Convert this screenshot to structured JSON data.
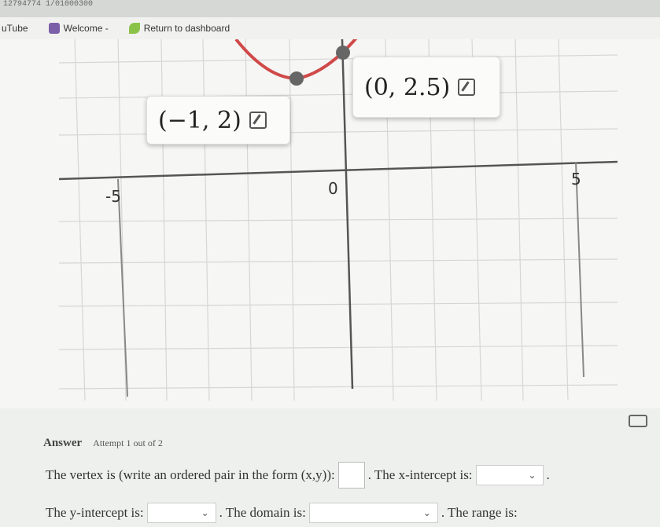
{
  "browser": {
    "top_strip_text": "12794774 1/01000300",
    "bookmarks": [
      {
        "label": "uTube",
        "icon": "none"
      },
      {
        "label": "Welcome -",
        "icon": "book-icon",
        "color": "#7b5ea8"
      },
      {
        "label": "Return to dashboard",
        "icon": "leaf-icon",
        "color": "#8bc34a"
      }
    ]
  },
  "graph": {
    "point_labels": [
      {
        "text": "(−1, 2)"
      },
      {
        "text": "(0, 2.5)"
      }
    ],
    "tick_labels": {
      "neg5": "-5",
      "zero": "0",
      "pos5": "5"
    },
    "curve_color": "#d04a4a",
    "point_color": "#666666"
  },
  "answer": {
    "heading": "Answer",
    "attempt": "Attempt 1 out of 2",
    "line1": {
      "vertex_prompt": "The vertex is (write an ordered pair in the form (x,y)):",
      "xint_prompt": ". The x-intercept is:",
      "end": "."
    },
    "line2": {
      "yint_prompt": "The y-intercept is:",
      "domain_prompt": ". The domain is:",
      "range_prompt": ". The range is:"
    },
    "dropdown_caret": "⌄"
  }
}
